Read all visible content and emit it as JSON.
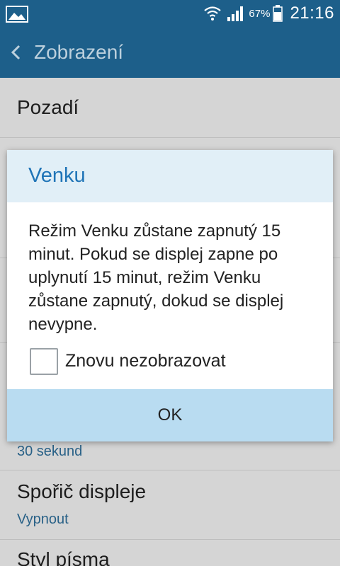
{
  "status_bar": {
    "battery_percent": "67%",
    "time": "21:16",
    "icons": [
      "image-icon",
      "wifi-icon",
      "signal-icon",
      "battery-icon"
    ]
  },
  "app_bar": {
    "title": "Zobrazení"
  },
  "settings": [
    {
      "title": "Pozadí",
      "subtitle": ""
    },
    {
      "title": "",
      "subtitle": "30 sekund"
    },
    {
      "title": "Spořič displeje",
      "subtitle": "Vypnout"
    },
    {
      "title": "Styl písma",
      "subtitle": ""
    }
  ],
  "dialog": {
    "title": "Venku",
    "message": "Režim Venku zůstane zapnutý 15 minut. Pokud se displej zapne po uplynutí 15 minut, režim Venku zůstane zapnutý, dokud se displej nevypne.",
    "checkbox_label": "Znovu nezobrazovat",
    "checkbox_checked": false,
    "ok_label": "OK"
  },
  "colors": {
    "bar": "#1d5f8a",
    "dialog_header": "#e1eff7",
    "dialog_title": "#1f74b7",
    "button_bar": "#b9dcf1",
    "subtitle": "#2f6f9a"
  }
}
